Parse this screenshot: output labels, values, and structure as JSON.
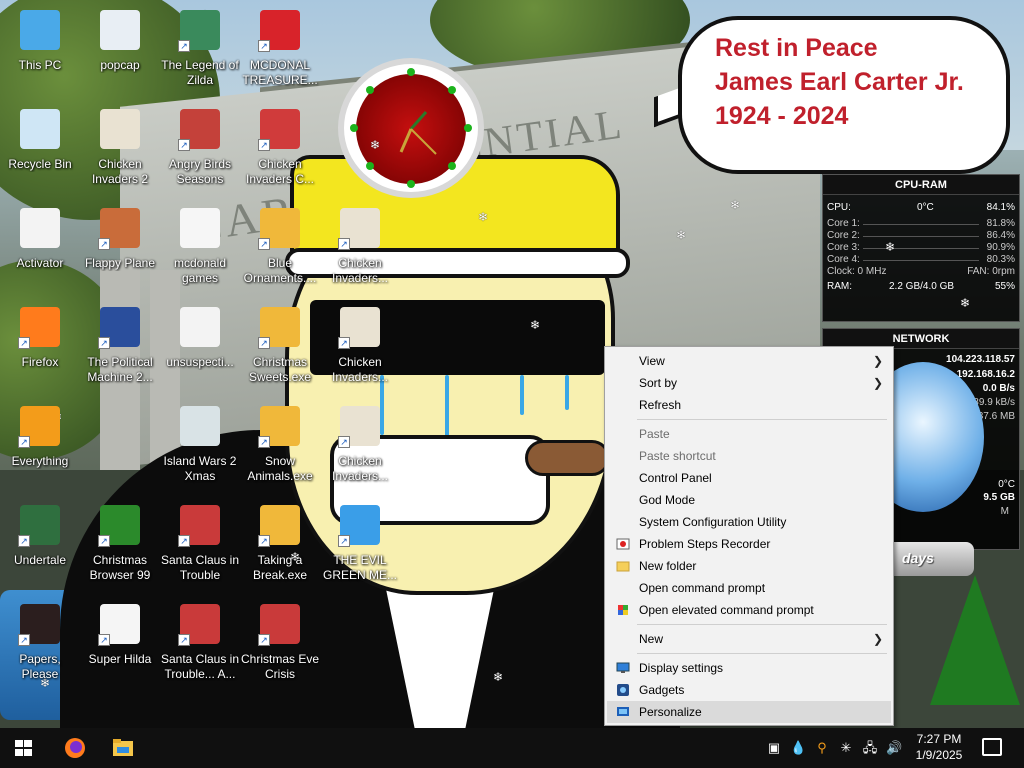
{
  "speech_bubble": {
    "line1": "Rest in Peace",
    "line2": "James Earl Carter Jr.",
    "line3": "1924 - 2024"
  },
  "wallpaper": {
    "building_text_1": "CARTE",
    "building_text_2": "ENTIAL"
  },
  "desktop_icons": [
    {
      "label": "This PC",
      "icon": "computer-icon",
      "shortcut": false
    },
    {
      "label": "popcap",
      "icon": "folder-icon",
      "shortcut": false
    },
    {
      "label": "The Legend of Zilda",
      "icon": "game-character-icon",
      "shortcut": true
    },
    {
      "label": "MCDONAL TREASURE...",
      "icon": "mcdonalds-logo-icon",
      "shortcut": true
    },
    {
      "label": "Recycle Bin",
      "icon": "recycle-bin-icon",
      "shortcut": false
    },
    {
      "label": "Chicken Invaders 2",
      "icon": "chicken-icon",
      "shortcut": false
    },
    {
      "label": "Angry Birds Seasons",
      "icon": "angry-birds-icon",
      "shortcut": true
    },
    {
      "label": "Chicken Invaders C...",
      "icon": "chicken-santa-icon",
      "shortcut": true
    },
    {
      "label": "Activator",
      "icon": "document-icon",
      "shortcut": false
    },
    {
      "label": "Flappy Plane",
      "icon": "plane-icon",
      "shortcut": true
    },
    {
      "label": "mcdonald games",
      "icon": "folder-white-icon",
      "shortcut": false
    },
    {
      "label": "Blue Ornaments....",
      "icon": "exe-icon",
      "shortcut": true
    },
    {
      "label": "Chicken Invaders...",
      "icon": "chicken-icon",
      "shortcut": true
    },
    {
      "label": "Firefox",
      "icon": "firefox-icon",
      "shortcut": true
    },
    {
      "label": "The Political Machine 2...",
      "icon": "political-machine-icon",
      "shortcut": true
    },
    {
      "label": "unsuspecti...",
      "icon": "document-icon",
      "shortcut": false
    },
    {
      "label": "Christmas Sweets.exe",
      "icon": "exe-icon",
      "shortcut": true
    },
    {
      "label": "Chicken Invaders...",
      "icon": "chicken-icon",
      "shortcut": true
    },
    {
      "label": "Everything",
      "icon": "search-icon",
      "shortcut": true
    },
    {
      "label": "Island Wars 2 Xmas",
      "icon": "island-wars-icon",
      "shortcut": false
    },
    {
      "label": "Snow Animals.exe",
      "icon": "exe-icon",
      "shortcut": true
    },
    {
      "label": "Chicken Invaders...",
      "icon": "chicken-icon",
      "shortcut": true
    },
    {
      "label": "Undertale",
      "icon": "undertale-icon",
      "shortcut": true
    },
    {
      "label": "Christmas Browser 99",
      "icon": "christmas-tree-icon",
      "shortcut": true
    },
    {
      "label": "Santa Claus in Trouble",
      "icon": "santa-icon",
      "shortcut": true
    },
    {
      "label": "Taking a Break.exe",
      "icon": "exe-icon",
      "shortcut": true
    },
    {
      "label": "THE EVIL GREEN ME...",
      "icon": "messenger-icon",
      "shortcut": true
    },
    {
      "label": "Papers, Please",
      "icon": "papers-please-icon",
      "shortcut": true
    },
    {
      "label": "Super Hilda",
      "icon": "pixel-dog-icon",
      "shortcut": true
    },
    {
      "label": "Santa Claus in Trouble... A...",
      "icon": "santa-icon",
      "shortcut": true
    },
    {
      "label": "Christmas Eve Crisis",
      "icon": "santa-icon",
      "shortcut": true
    }
  ],
  "cpu_gadget": {
    "title": "CPU-RAM",
    "cpu_label": "CPU:",
    "cpu_temp": "0°C",
    "cpu_pct": "84.1%",
    "cores": [
      {
        "label": "Core 1:",
        "value": "81.8%"
      },
      {
        "label": "Core 2:",
        "value": "86.4%"
      },
      {
        "label": "Core 3:",
        "value": "90.9%"
      },
      {
        "label": "Core 4:",
        "value": "80.3%"
      }
    ],
    "clock": "Clock: 0 MHz",
    "fan": "FAN: 0rpm",
    "ram_label": "RAM:",
    "ram_value": "2.2 GB/4.0 GB",
    "ram_pct": "55%"
  },
  "network_gadget": {
    "title": "NETWORK",
    "ip_external": "104.223.118.57",
    "ip_local": "192.168.16.2",
    "speed_1": "0.0 B/s",
    "speed_2": "89.9 kB/s",
    "speed_3": "37.6 MB",
    "temp": "0°C",
    "disk": "9.5 GB",
    "unit": "M"
  },
  "snowglobe_label": "days",
  "context_menu": {
    "items": [
      {
        "label": "View",
        "submenu": true,
        "disabled": false
      },
      {
        "label": "Sort by",
        "submenu": true,
        "disabled": false
      },
      {
        "label": "Refresh",
        "submenu": false,
        "disabled": false
      },
      {
        "label": "Paste",
        "submenu": false,
        "disabled": true
      },
      {
        "label": "Paste shortcut",
        "submenu": false,
        "disabled": true
      },
      {
        "label": "Control Panel",
        "submenu": false,
        "disabled": false
      },
      {
        "label": "God Mode",
        "submenu": false,
        "disabled": false
      },
      {
        "label": "System Configuration Utility",
        "submenu": false,
        "disabled": false
      },
      {
        "label": "Problem Steps Recorder",
        "submenu": false,
        "disabled": false,
        "icon": "recorder-icon"
      },
      {
        "label": "New folder",
        "submenu": false,
        "disabled": false,
        "icon": "folder-icon"
      },
      {
        "label": "Open command prompt",
        "submenu": false,
        "disabled": false
      },
      {
        "label": "Open elevated command prompt",
        "submenu": false,
        "disabled": false,
        "icon": "shield-icon"
      },
      {
        "label": "New",
        "submenu": true,
        "disabled": false
      },
      {
        "label": "Display settings",
        "submenu": false,
        "disabled": false,
        "icon": "display-icon"
      },
      {
        "label": "Gadgets",
        "submenu": false,
        "disabled": false,
        "icon": "gadgets-icon"
      },
      {
        "label": "Personalize",
        "submenu": false,
        "disabled": false,
        "icon": "personalize-icon",
        "highlighted": true
      }
    ]
  },
  "taskbar": {
    "pinned": [
      "windows-start-icon",
      "firefox-icon",
      "file-explorer-icon"
    ],
    "tray_icons": [
      "app-icon",
      "droplet-icon",
      "everything-search-icon",
      "snowflake-icon",
      "network-icon",
      "volume-icon"
    ],
    "time": "7:27 PM",
    "date": "1/9/2025"
  },
  "colors": {
    "bubble_text": "#c0202c",
    "menu_bg": "#f2f2f2",
    "taskbar_bg": "#101010"
  }
}
